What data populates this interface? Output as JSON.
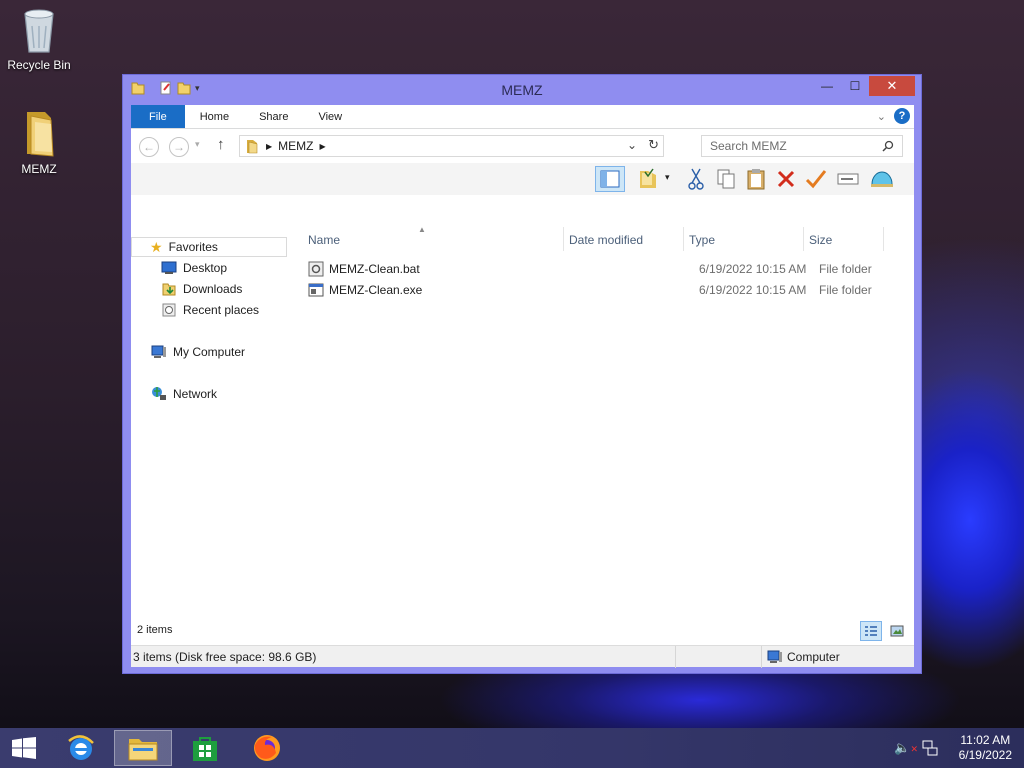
{
  "desktop": {
    "icons": [
      {
        "label": "Recycle Bin",
        "icon": "recycle-bin-icon"
      },
      {
        "label": "MEMZ",
        "icon": "folder-icon"
      }
    ]
  },
  "window": {
    "title": "MEMZ",
    "accent_color": "#8f8df0",
    "close_color": "#c84a3e"
  },
  "ribbon": {
    "tabs": [
      "File",
      "Home",
      "Share",
      "View"
    ],
    "file_tab_color": "#1a6dc6",
    "help_label": "?"
  },
  "address": {
    "path": [
      "MEMZ"
    ],
    "search_placeholder": "Search MEMZ"
  },
  "navpane": {
    "favorites": {
      "label": "Favorites",
      "items": [
        "Desktop",
        "Downloads",
        "Recent places"
      ]
    },
    "computer": "My Computer",
    "network": "Network"
  },
  "columns": [
    "Name",
    "Date modified",
    "Type",
    "Size"
  ],
  "files": [
    {
      "name": "MEMZ-Clean.bat",
      "date": "6/19/2022 10:15 AM",
      "type": "File folder",
      "size": ""
    },
    {
      "name": "MEMZ-Clean.exe",
      "date": "6/19/2022 10:15 AM",
      "type": "File folder",
      "size": ""
    }
  ],
  "item_count": "2 items",
  "status": {
    "left": "3 items (Disk free space: 98.6 GB)",
    "right": "Computer"
  },
  "taskbar": {
    "apps": [
      "start-button",
      "internet-explorer-icon",
      "file-explorer-icon",
      "store-icon",
      "firefox-icon"
    ],
    "time": "11:02 AM",
    "date": "6/19/2022"
  }
}
